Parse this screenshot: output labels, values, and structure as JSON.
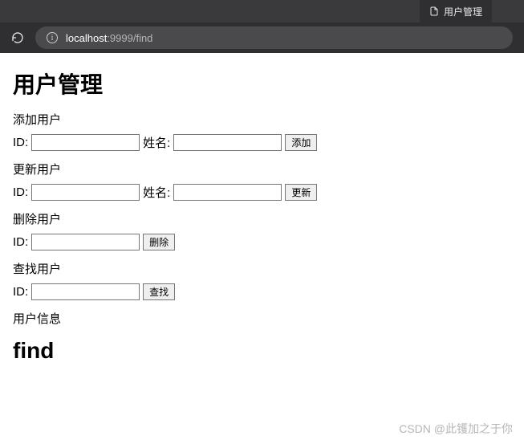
{
  "browser": {
    "tab_title": "用户管理",
    "url_host": "localhost",
    "url_port_path": ":9999/find"
  },
  "page": {
    "title": "用户管理",
    "add": {
      "section": "添加用户",
      "id_label": "ID:",
      "name_label": "姓名:",
      "button": "添加"
    },
    "update": {
      "section": "更新用户",
      "id_label": "ID:",
      "name_label": "姓名:",
      "button": "更新"
    },
    "delete": {
      "section": "删除用户",
      "id_label": "ID:",
      "button": "删除"
    },
    "find": {
      "section": "查找用户",
      "id_label": "ID:",
      "button": "查找"
    },
    "info_label": "用户信息",
    "result": "find"
  },
  "watermark": "CSDN @此镬加之于你"
}
